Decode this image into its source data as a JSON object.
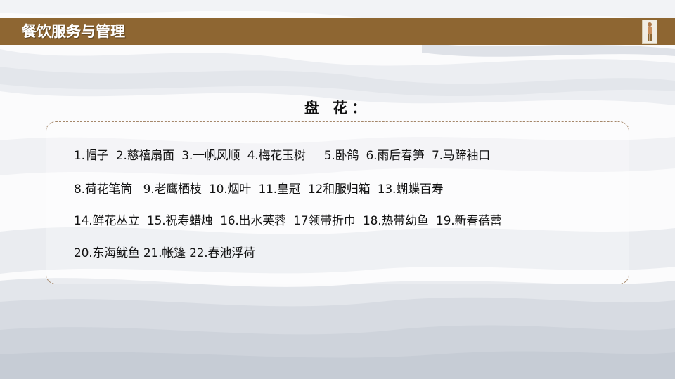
{
  "header": {
    "title": "餐饮服务与管理"
  },
  "main": {
    "heading": "盘 花：",
    "lines": [
      "1.帽子  2.慈禧扇面  3.一帆风顺  4.梅花玉树     5.卧鸽  6.雨后春笋  7.马蹄袖口",
      "8.荷花笔筒   9.老鹰栖枝  10.烟叶  11.皇冠  12和服归箱  13.蝴蝶百寿",
      "14.鲜花丛立  15.祝寿蜡烛  16.出水芙蓉  17领带折巾  18.热带幼鱼  19.新春蓓蕾",
      "20.东海鱿鱼 21.帐篷 22.春池浮荷"
    ]
  },
  "colors": {
    "header_bar": "#8e6632",
    "box_border": "#a5876a",
    "wave_light": "#eef0f3",
    "wave_mid": "#d9dde3"
  }
}
